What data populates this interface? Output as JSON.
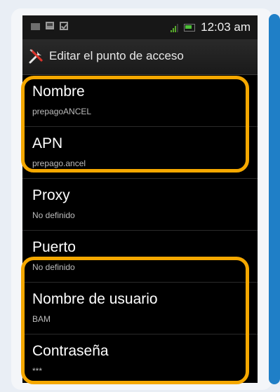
{
  "statusbar": {
    "time": "12:03 am",
    "icons": [
      "message-icon",
      "picture-icon",
      "checkbox-icon",
      "signal-icon",
      "battery-icon"
    ]
  },
  "titlebar": {
    "icon": "wrench-screwdriver-icon",
    "title": "Editar el punto de acceso"
  },
  "settings": [
    {
      "label": "Nombre",
      "value": "prepagoANCEL"
    },
    {
      "label": "APN",
      "value": "prepago.ancel"
    },
    {
      "label": "Proxy",
      "value": "No definido"
    },
    {
      "label": "Puerto",
      "value": "No definido"
    },
    {
      "label": "Nombre de usuario",
      "value": "BAM"
    },
    {
      "label": "Contraseña",
      "value": "***"
    }
  ],
  "colors": {
    "highlight": "#f5a800",
    "frame_accent": "#1f7fc7",
    "background": "#000000"
  }
}
